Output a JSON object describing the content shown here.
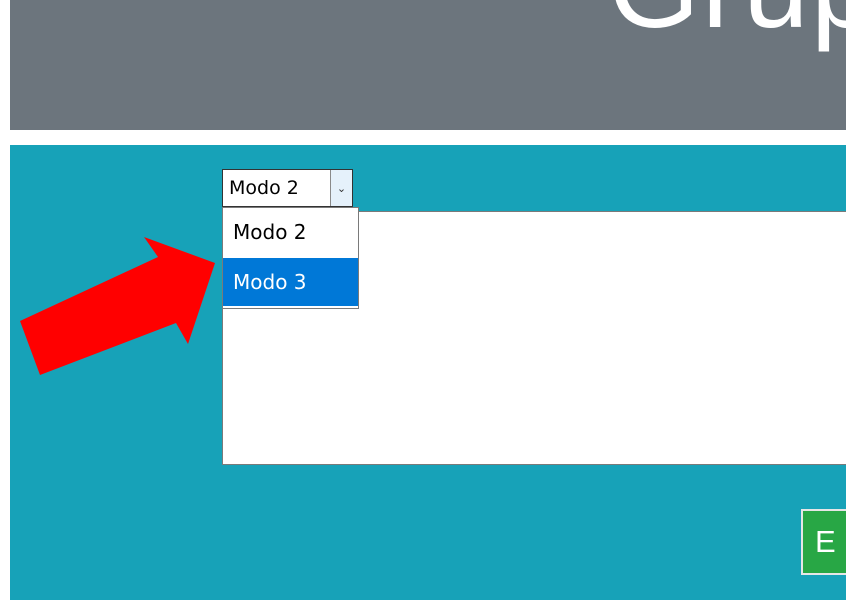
{
  "header": {
    "title": "Grup"
  },
  "mode_select": {
    "value": "Modo 2",
    "arrow_icon": "chevron-down-icon",
    "options": [
      "Modo 2",
      "Modo 3"
    ],
    "highlighted_option": "Modo 3"
  },
  "text_area": {
    "value": ""
  },
  "action_button": {
    "label": "E"
  },
  "colors": {
    "header": "#6c757d",
    "panel": "#17a2b8",
    "highlight": "#0078d7",
    "button": "#28a745",
    "arrow": "#ff0000"
  },
  "annotation": {
    "icon": "red-arrow-icon"
  }
}
